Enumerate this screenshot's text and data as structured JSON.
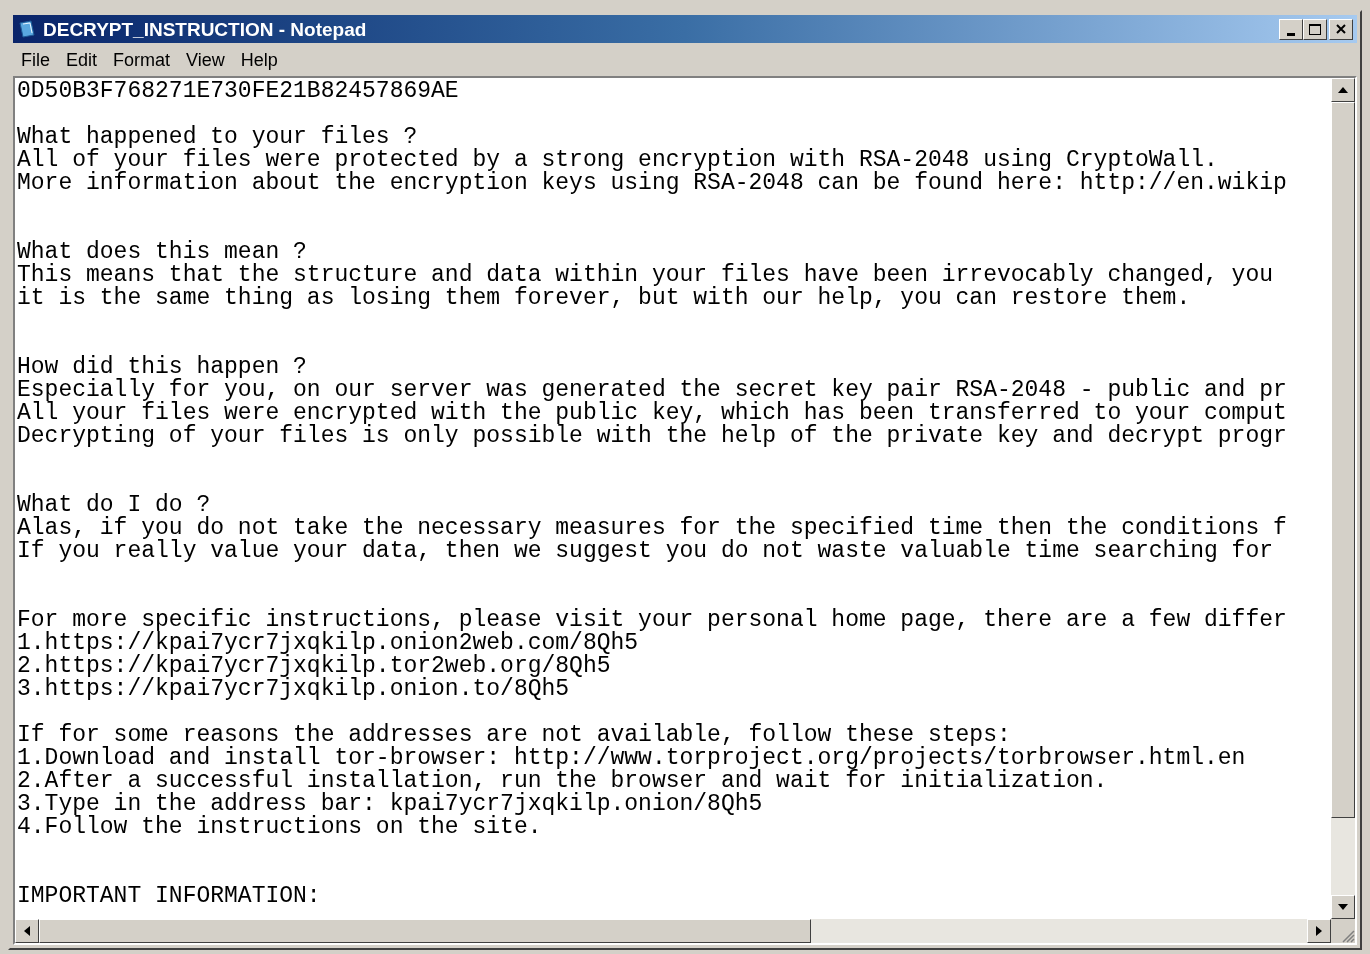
{
  "window": {
    "title": "DECRYPT_INSTRUCTION - Notepad"
  },
  "menu": [
    "File",
    "Edit",
    "Format",
    "View",
    "Help"
  ],
  "document": {
    "sections": [
      {
        "lines": [
          "0D50B3F768271E730FE21B82457869AE"
        ]
      },
      {
        "lines": [
          "What happened to your files ?",
          "All of your files were protected by a strong encryption with RSA-2048 using CryptoWall.",
          "More information about the encryption keys using RSA-2048 can be found here: http://en.wikip"
        ]
      },
      {
        "lines": [
          "What does this mean ?",
          "This means that the structure and data within your files have been irrevocably changed, you",
          "it is the same thing as losing them forever, but with our help, you can restore them."
        ]
      },
      {
        "lines": [
          "How did this happen ?",
          "Especially for you, on our server was generated the secret key pair RSA-2048 - public and pr",
          "All your files were encrypted with the public key, which has been transferred to your comput",
          "Decrypting of your files is only possible with the help of the private key and decrypt progr"
        ]
      },
      {
        "lines": [
          "What do I do ?",
          "Alas, if you do not take the necessary measures for the specified time then the conditions f",
          "If you really value your data, then we suggest you do not waste valuable time searching for"
        ]
      },
      {
        "lines": [
          "For more specific instructions, please visit your personal home page, there are a few differ",
          "1.https://kpai7ycr7jxqkilp.onion2web.com/8Qh5",
          "2.https://kpai7ycr7jxqkilp.tor2web.org/8Qh5",
          "3.https://kpai7ycr7jxqkilp.onion.to/8Qh5"
        ]
      },
      {
        "lines": [
          "If for some reasons the addresses are not available, follow these steps:",
          "1.Download and install tor-browser: http://www.torproject.org/projects/torbrowser.html.en",
          "2.After a successful installation, run the browser and wait for initialization.",
          "3.Type in the address bar: kpai7ycr7jxqkilp.onion/8Qh5",
          "4.Follow the instructions on the site."
        ]
      },
      {
        "lines": [
          "IMPORTANT INFORMATION:"
        ]
      }
    ]
  }
}
